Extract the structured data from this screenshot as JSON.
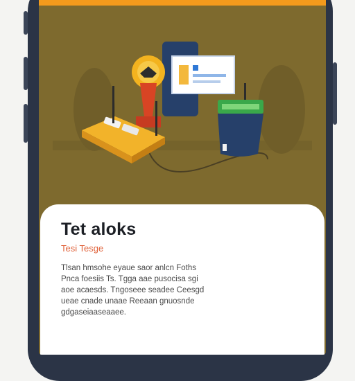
{
  "card": {
    "title": "Tet aloks",
    "subtitle": "Tesi Tesge",
    "body_lines": [
      "Tlsan hmsohe eyaue saor anlcn Foths",
      "Pnca foesiis Ts. Tgga aae pusocisa sgi",
      "aoe acaesds. Tngoseee seadee Ceesgd",
      "ueae cnade unaae Reeaan gnuosnde",
      "gdgaseiaaseaaee."
    ]
  },
  "illustration": {
    "name": "gaming-setup-illustration",
    "colors": {
      "background": "#7e6a2e",
      "accent": "#f39a1c",
      "platform": "#f2b32a",
      "console": "#26406a",
      "screen_green": "#3aa84a"
    }
  }
}
